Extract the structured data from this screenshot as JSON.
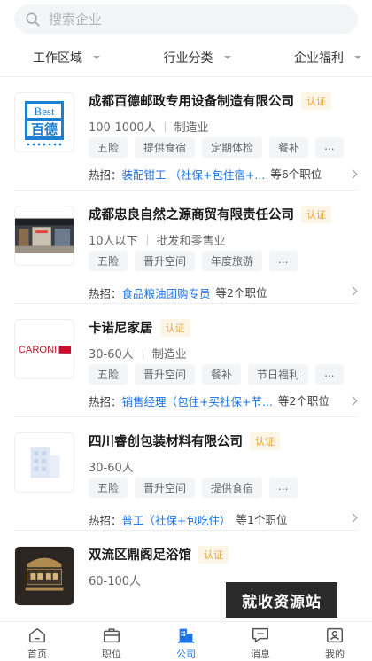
{
  "search": {
    "placeholder": "搜索企业"
  },
  "filters": [
    "工作区域",
    "行业分类",
    "企业福利"
  ],
  "logos": {
    "best_top": "Best",
    "best_bottom": "百德",
    "caroni": "CARONI"
  },
  "companies": [
    {
      "name": "成都百德邮政专用设备制造有限公司",
      "badge": "认证",
      "size": "100-1000人",
      "industry": "制造业",
      "tags": [
        "五险",
        "提供食宿",
        "定期体检",
        "餐补",
        "..."
      ],
      "hire_label": "热招：",
      "job": "装配钳工 （社保+包住宿+...",
      "count": "等6个职位"
    },
    {
      "name": "成都忠良自然之源商贸有限责任公司",
      "badge": "认证",
      "size": "10人以下",
      "industry": "批发和零售业",
      "tags": [
        "五险",
        "晋升空间",
        "年度旅游",
        "..."
      ],
      "hire_label": "热招：",
      "job": "食品粮油团购专员",
      "count": "等2个职位"
    },
    {
      "name": "卡诺尼家居",
      "badge": "认证",
      "size": "30-60人",
      "industry": "制造业",
      "tags": [
        "五险",
        "晋升空间",
        "餐补",
        "节日福利",
        "..."
      ],
      "hire_label": "热招：",
      "job": "销售经理（包住+买社保+节...",
      "count": "等2个职位"
    },
    {
      "name": "四川睿创包装材料有限公司",
      "badge": "认证",
      "size": "30-60人",
      "industry": "",
      "tags": [
        "五险",
        "晋升空间",
        "提供食宿",
        "..."
      ],
      "hire_label": "热招：",
      "job": "普工（社保+包吃住）",
      "count": "等1个职位"
    },
    {
      "name": "双流区鼎阁足浴馆",
      "badge": "认证",
      "size": "60-100人",
      "industry": ""
    }
  ],
  "watermark": "就收资源站",
  "tabs": [
    {
      "label": "首页",
      "icon": "home-icon"
    },
    {
      "label": "职位",
      "icon": "briefcase-icon"
    },
    {
      "label": "公司",
      "icon": "building-icon",
      "active": true
    },
    {
      "label": "消息",
      "icon": "message-icon"
    },
    {
      "label": "我的",
      "icon": "profile-icon"
    }
  ],
  "colors": {
    "accent": "#1a73e8",
    "badge": "#e6a23c",
    "badge_bg": "#fdf5e6",
    "tag_bg": "#f4f5f7"
  }
}
